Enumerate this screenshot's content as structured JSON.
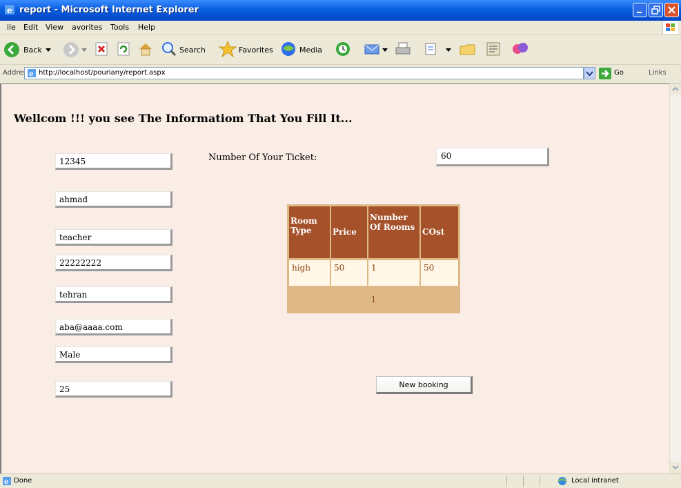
{
  "window": {
    "title": "report - Microsoft Internet Explorer"
  },
  "menu": [
    "ile",
    "Edit",
    "View",
    "avorites",
    "Tools",
    "Help"
  ],
  "toolbar": {
    "back": "Back",
    "search": "Search",
    "favorites": "Favorites",
    "media": "Media"
  },
  "address": {
    "label": "Address",
    "url": "http://localhost/pouriany/report.aspx",
    "go": "Go",
    "links": "Links"
  },
  "page": {
    "heading": "Wellcom !!! you see The Informatiom That You Fill It...",
    "fields": [
      "12345",
      "ahmad",
      "teacher",
      "22222222",
      "tehran",
      "aba@aaaa.com",
      "Male",
      "25"
    ],
    "tickets_label": "Number Of Your Ticket:",
    "tickets_value": "60",
    "table": {
      "headers": [
        "Room Type",
        "Price",
        "Number Of Rooms",
        "COst"
      ],
      "rows": [
        [
          "high",
          "50",
          "1",
          "50"
        ]
      ],
      "pager": "1"
    },
    "new_booking": "New booking"
  },
  "status": {
    "text": "Done",
    "zone": "Local intranet"
  },
  "colors": {
    "header_bg": "#A55129",
    "cell_bg": "#FFF7E7",
    "table_bg": "#DEB887",
    "page_bg": "#F9EDE5"
  }
}
